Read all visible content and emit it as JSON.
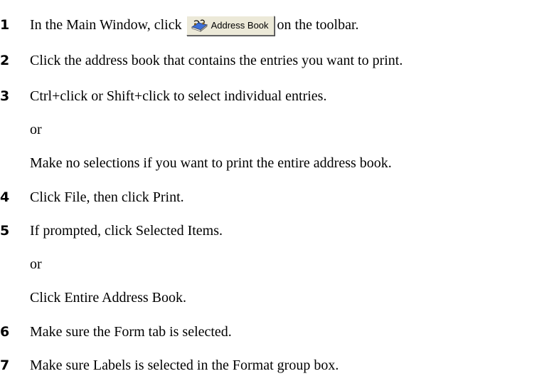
{
  "steps": [
    {
      "number": "1",
      "text_before": "In the Main Window, click",
      "button": {
        "label": "Address Book",
        "icon": "address-book-icon"
      },
      "text_after": "on the toolbar."
    },
    {
      "number": "2",
      "text": "Click the address book that contains the entries you want to print."
    },
    {
      "number": "3",
      "text": "Ctrl+click or Shift+click to select individual entries.",
      "sub_or": "or",
      "sub_text": "Make no selections if you want to print the entire address book."
    },
    {
      "number": "4",
      "text": "Click File, then click Print."
    },
    {
      "number": "5",
      "text": "If prompted, click Selected Items.",
      "sub_or": "or",
      "sub_text": "Click Entire Address Book."
    },
    {
      "number": "6",
      "text": "Make sure the Form tab is selected."
    },
    {
      "number": "7",
      "text": "Make sure Labels is selected in the Format group box."
    }
  ],
  "colors": {
    "text": "#000000",
    "background": "#ffffff",
    "button_face": "#ece9d8"
  }
}
